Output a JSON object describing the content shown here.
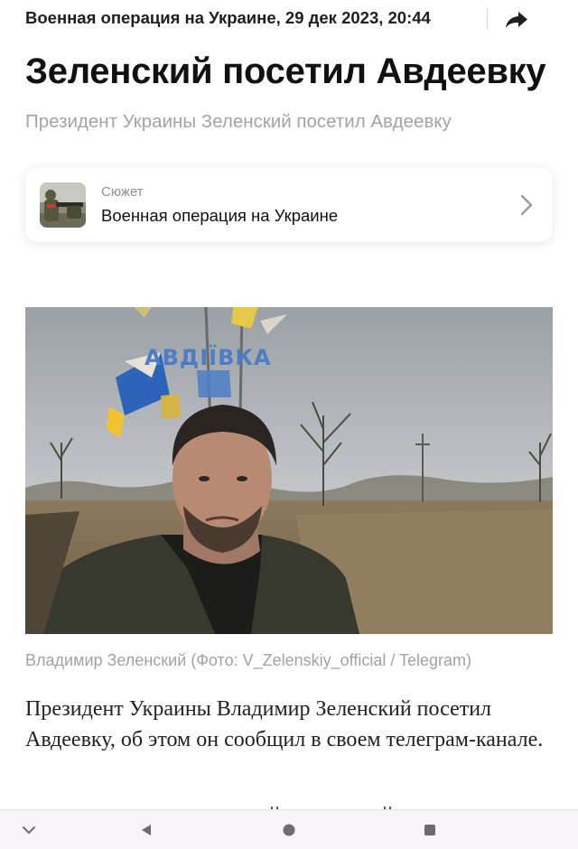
{
  "header": {
    "breadcrumb": "Военная операция на Украине, 29 дек 2023, 20:44",
    "share_icon": "share-arrow-icon"
  },
  "article": {
    "title": "Зеленский посетил Авдеевку",
    "subtitle": "Президент Украины Зеленский посетил Авдеевку",
    "story_card": {
      "kicker": "Сюжет",
      "name": "Военная операция на Украине",
      "chevron_icon": "chevron-right-icon"
    },
    "photo": {
      "sign_text": "АВДІЇВКА",
      "caption": "Владимир Зеленский (Фото: V_Zelenskiy_official / Telegram)"
    },
    "lead": "Президент Украины Владимир Зеленский посетил Авдеевку, об этом он сообщил в своем телеграм-канале."
  },
  "system_nav": {
    "icons": [
      "chevron-down-icon",
      "back-triangle-icon",
      "home-circle-icon",
      "recents-square-icon"
    ]
  },
  "colors": {
    "text_primary": "#111111",
    "text_secondary": "#a3a3a3",
    "nav_bar": "#f7f3f7"
  }
}
